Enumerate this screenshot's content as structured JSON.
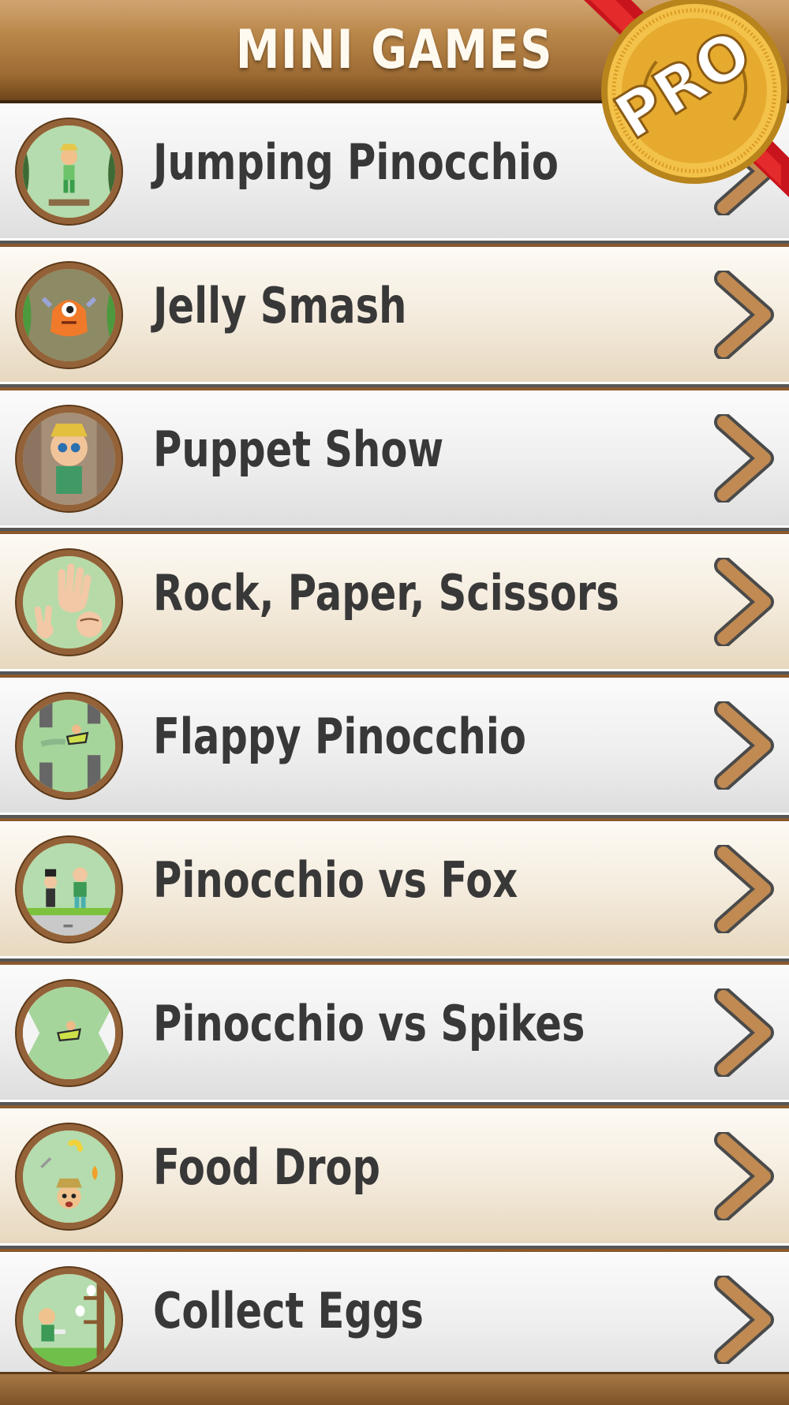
{
  "header": {
    "title": "MINI GAMES"
  },
  "badge": {
    "label": "PRO",
    "icon": "pro-medal-icon"
  },
  "games": [
    {
      "label": "Jumping Pinocchio",
      "icon": "jumping-pinocchio-icon",
      "bg": "grey"
    },
    {
      "label": "Jelly Smash",
      "icon": "jelly-smash-icon",
      "bg": "cream"
    },
    {
      "label": "Puppet Show",
      "icon": "puppet-show-icon",
      "bg": "grey"
    },
    {
      "label": "Rock, Paper, Scissors",
      "icon": "rock-paper-scissors-icon",
      "bg": "cream"
    },
    {
      "label": "Flappy Pinocchio",
      "icon": "flappy-pinocchio-icon",
      "bg": "grey"
    },
    {
      "label": "Pinocchio vs Fox",
      "icon": "pinocchio-vs-fox-icon",
      "bg": "cream"
    },
    {
      "label": "Pinocchio vs Spikes",
      "icon": "pinocchio-vs-spikes-icon",
      "bg": "grey"
    },
    {
      "label": "Food Drop",
      "icon": "food-drop-icon",
      "bg": "cream"
    },
    {
      "label": "Collect Eggs",
      "icon": "collect-eggs-icon",
      "bg": "grey"
    }
  ],
  "colors": {
    "header": "#b98649",
    "chevron": "#c08a52",
    "ring": "#946238",
    "text": "#383838"
  }
}
